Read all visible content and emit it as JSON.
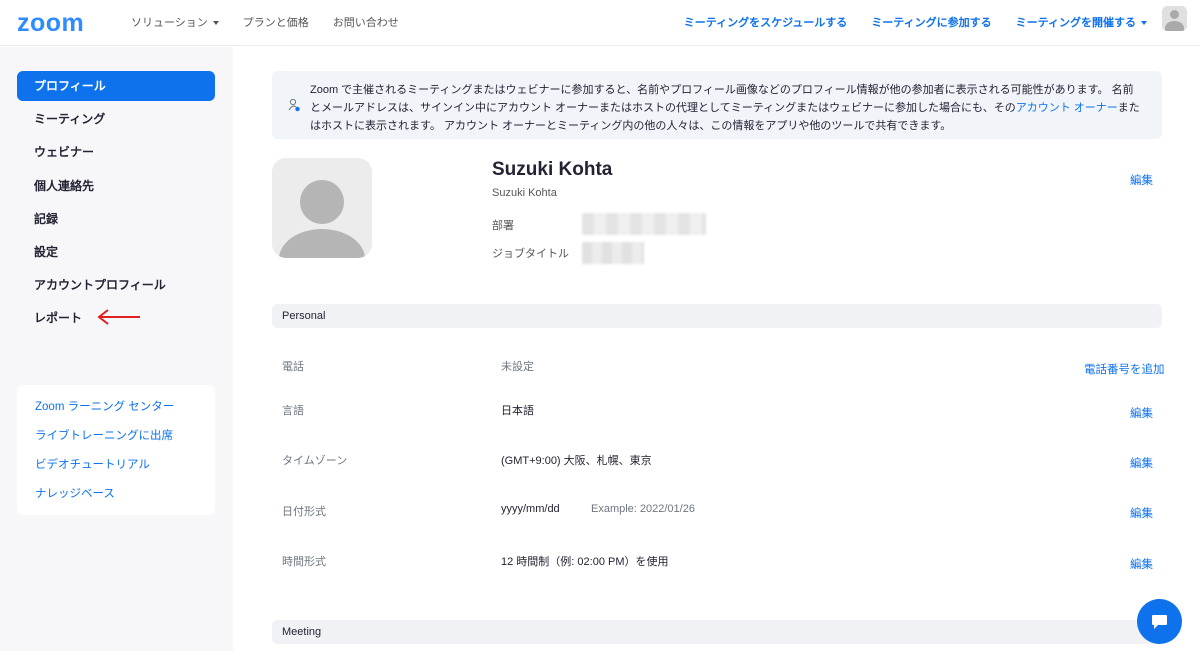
{
  "header": {
    "logo": "zoom",
    "nav_left": [
      "ソリューション",
      "プランと価格",
      "お問い合わせ"
    ],
    "nav_right": [
      "ミーティングをスケジュールする",
      "ミーティングに参加する",
      "ミーティングを開催する"
    ]
  },
  "sidebar": {
    "items": [
      "プロフィール",
      "ミーティング",
      "ウェビナー",
      "個人連絡先",
      "記録",
      "設定",
      "アカウントプロフィール",
      "レポート"
    ],
    "active_index": 0,
    "links": [
      "Zoom ラーニング センター",
      "ライブトレーニングに出席",
      "ビデオチュートリアル",
      "ナレッジベース"
    ]
  },
  "notice": {
    "text_before": "Zoom で主催されるミーティングまたはウェビナーに参加すると、名前やプロフィール画像などのプロフィール情報が他の参加者に表示される可能性があります。 名前とメールアドレスは、サインイン中にアカウント オーナーまたはホストの代理としてミーティングまたはウェビナーに参加した場合にも、その",
    "link": "アカウント オーナー",
    "text_after": "またはホストに表示されます。 アカウント オーナーとミーティング内の他の人々は、この情報をアプリや他のツールで共有できます。"
  },
  "profile": {
    "name": "Suzuki Kohta",
    "subname": "Suzuki Kohta",
    "dept_label": "部署",
    "job_label": "ジョブタイトル",
    "edit": "編集"
  },
  "personal": {
    "title": "Personal",
    "phone": {
      "label": "電話",
      "value": "未設定",
      "action": "電話番号を追加"
    },
    "language": {
      "label": "言語",
      "value": "日本語",
      "action": "編集"
    },
    "timezone": {
      "label": "タイムゾーン",
      "value": "(GMT+9:00) 大阪、札幌、東京",
      "action": "編集"
    },
    "date_format": {
      "label": "日付形式",
      "value": "yyyy/mm/dd",
      "example": "Example: 2022/01/26",
      "action": "編集"
    },
    "time_format": {
      "label": "時間形式",
      "value": "12 時間制（例: 02:00 PM）を使用",
      "action": "編集"
    }
  },
  "meeting": {
    "title": "Meeting"
  },
  "colors": {
    "accent": "#0E72ED",
    "logo": "#2D8CFF",
    "annotation_arrow": "#E02020"
  }
}
